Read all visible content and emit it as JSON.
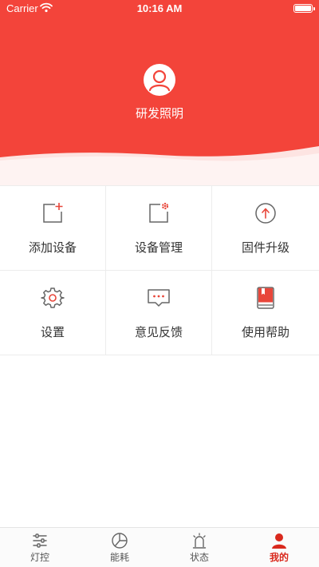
{
  "status_bar": {
    "carrier": "Carrier",
    "time": "10:16 AM"
  },
  "profile": {
    "name": "研发照明"
  },
  "menu": [
    {
      "label": "添加设备",
      "icon": "add-device-icon"
    },
    {
      "label": "设备管理",
      "icon": "device-manage-icon"
    },
    {
      "label": "固件升级",
      "icon": "firmware-upgrade-icon"
    },
    {
      "label": "设置",
      "icon": "settings-gear-icon"
    },
    {
      "label": "意见反馈",
      "icon": "feedback-icon"
    },
    {
      "label": "使用帮助",
      "icon": "help-book-icon"
    }
  ],
  "tabs": [
    {
      "label": "灯控",
      "icon": "sliders-icon"
    },
    {
      "label": "能耗",
      "icon": "pie-chart-icon"
    },
    {
      "label": "状态",
      "icon": "alarm-light-icon"
    },
    {
      "label": "我的",
      "icon": "user-icon",
      "active": true
    }
  ],
  "colors": {
    "primary": "#f3443a",
    "active_tab": "#d9291d",
    "icon_gray": "#666666"
  }
}
